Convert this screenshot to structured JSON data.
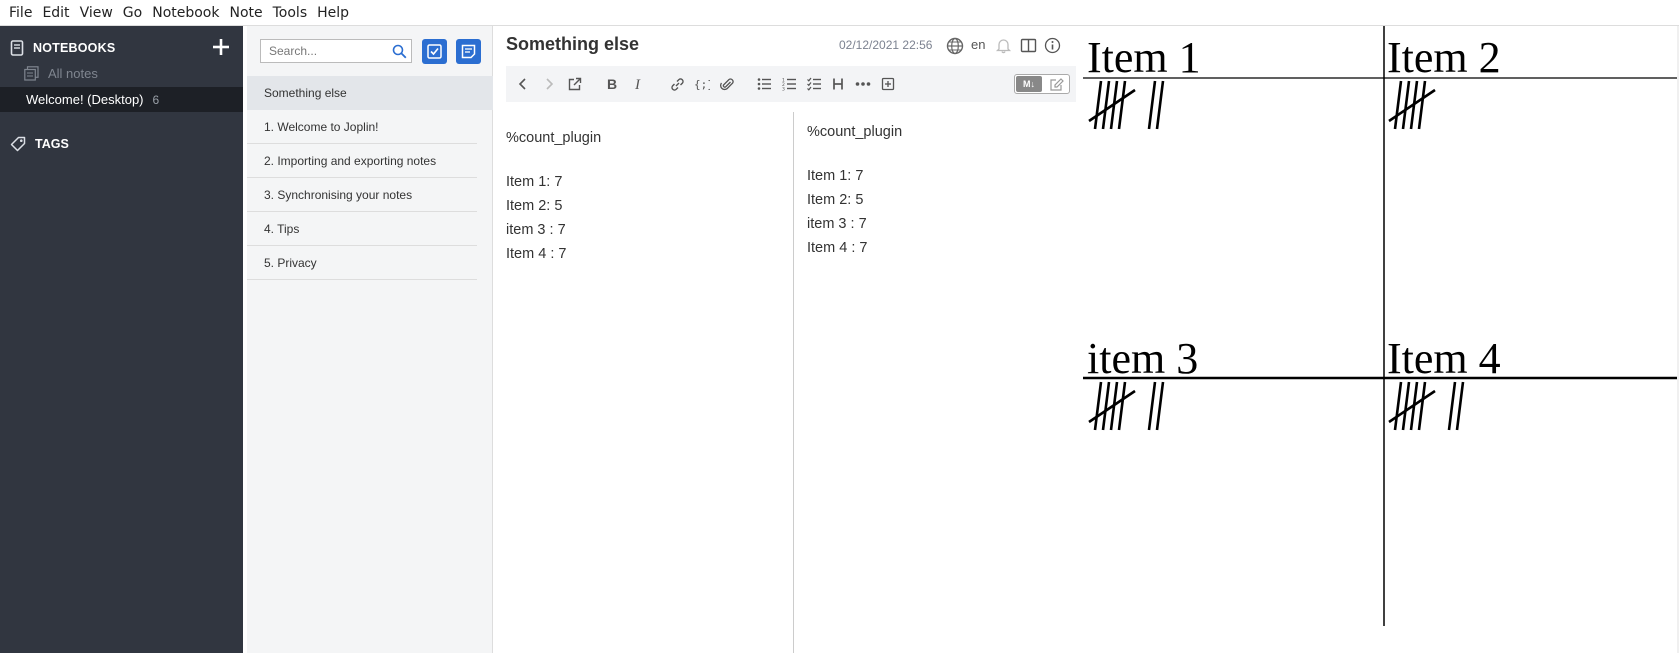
{
  "menubar": {
    "items": [
      "File",
      "Edit",
      "View",
      "Go",
      "Notebook",
      "Note",
      "Tools",
      "Help"
    ]
  },
  "sidebar": {
    "notebooks_label": "NOTEBOOKS",
    "all_notes_label": "All notes",
    "notebook": {
      "name": "Welcome! (Desktop)",
      "count": "6"
    },
    "tags_label": "TAGS"
  },
  "notelist": {
    "search_placeholder": "Search...",
    "items": [
      "Something else",
      "1. Welcome to Joplin!",
      "2. Importing and exporting notes",
      "3. Synchronising your notes",
      "4. Tips",
      "5. Privacy"
    ]
  },
  "editor": {
    "title": "Something else",
    "date": "02/12/2021 22:56",
    "lang": "en",
    "toggle_md_label": "M↓",
    "markdown": {
      "header": "%count_plugin",
      "lines": [
        "Item 1: 7",
        "Item 2: 5",
        "item 3 : 7",
        "Item 4 : 7"
      ]
    },
    "viewer": {
      "header": "%count_plugin",
      "lines": [
        "Item 1: 7",
        "Item 2: 5",
        "item 3 : 7",
        "Item 4 : 7"
      ]
    }
  },
  "plugin": {
    "items": [
      {
        "label": "Item 1",
        "count": 7
      },
      {
        "label": "Item 2",
        "count": 5
      },
      {
        "label": "item 3",
        "count": 7
      },
      {
        "label": "Item 4",
        "count": 7
      }
    ]
  },
  "colors": {
    "sidebar_bg": "#313640",
    "accent": "#2b6ed1"
  }
}
